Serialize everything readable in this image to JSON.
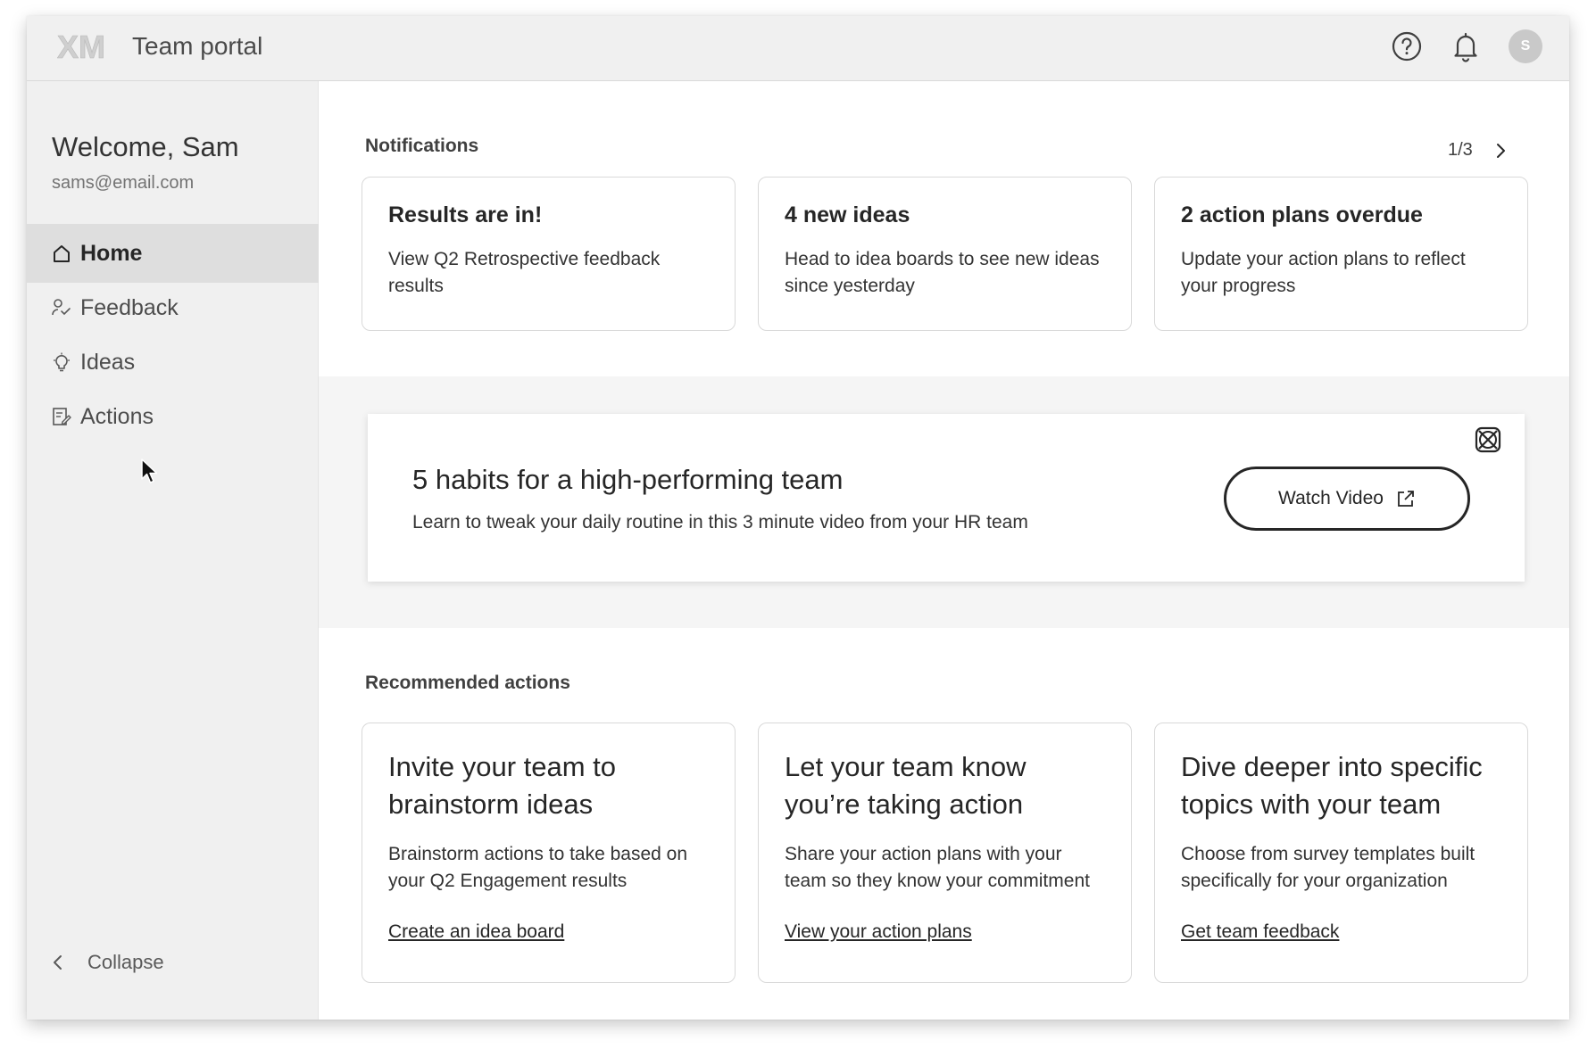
{
  "app": {
    "logo_text": "XM",
    "title": "Team portal"
  },
  "header": {
    "help_icon": "help-circle-icon",
    "bell_icon": "bell-icon",
    "avatar_initial": "S"
  },
  "sidebar": {
    "welcome": "Welcome, Sam",
    "email": "sams@email.com",
    "items": [
      {
        "label": "Home",
        "icon": "home-icon",
        "active": true
      },
      {
        "label": "Feedback",
        "icon": "feedback-icon",
        "active": false
      },
      {
        "label": "Ideas",
        "icon": "lightbulb-icon",
        "active": false
      },
      {
        "label": "Actions",
        "icon": "actions-icon",
        "active": false
      }
    ],
    "collapse_label": "Collapse"
  },
  "notifications": {
    "title": "Notifications",
    "pager": "1/3",
    "cards": [
      {
        "title": "Results are in!",
        "body": "View Q2 Retrospective feedback results"
      },
      {
        "title": "4 new ideas",
        "body": "Head to idea boards to see new ideas since yesterday"
      },
      {
        "title": "2 action plans overdue",
        "body": "Update your action plans to reflect your progress"
      }
    ]
  },
  "promo": {
    "title": "5 habits for a high-performing team",
    "subtitle": "Learn to tweak your daily routine in this 3 minute video from your HR team",
    "button_label": "Watch Video"
  },
  "recommended": {
    "title": "Recommended actions",
    "cards": [
      {
        "title": "Invite your team to brainstorm ideas",
        "body": "Brainstorm actions to take based on your Q2 Engagement results",
        "link": "Create an idea board"
      },
      {
        "title": "Let your team know you’re taking action",
        "body": "Share your action plans with your team so they know your commitment",
        "link": "View your action plans"
      },
      {
        "title": "Dive deeper into specific topics with your team",
        "body": "Choose from survey templates built specifically for your organization",
        "link": "Get team feedback"
      }
    ]
  },
  "colors": {
    "sidebar_bg": "#f0f0f0",
    "active_item_bg": "#dedede",
    "text": "#262626"
  }
}
